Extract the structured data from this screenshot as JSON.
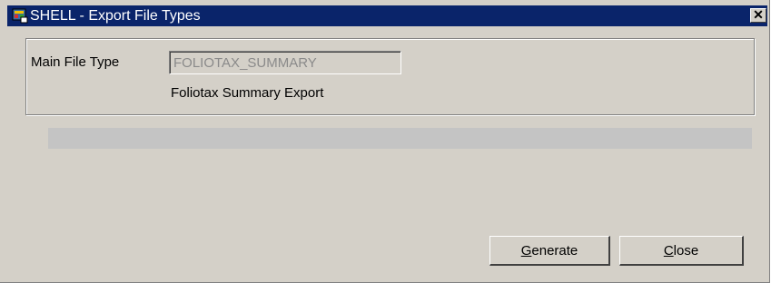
{
  "window": {
    "title": "SHELL - Export File Types",
    "close_glyph": "✕"
  },
  "form": {
    "main_file_type_label": "Main File Type",
    "main_file_type_value": "FOLIOTAX_SUMMARY",
    "description": "Foliotax Summary Export"
  },
  "progress": {
    "fraction": 0
  },
  "buttons": {
    "generate_mnemonic": "G",
    "generate_rest": "enerate",
    "close_mnemonic": "C",
    "close_rest": "lose"
  },
  "icons": {
    "app_icon": "app-window-icon",
    "close": "close-icon"
  }
}
